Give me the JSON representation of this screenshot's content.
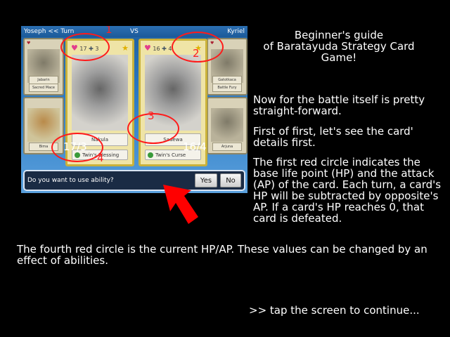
{
  "game": {
    "top_bar": {
      "left": "Yoseph << Turn",
      "center": "VS",
      "right": "Kyriel"
    },
    "left_card": {
      "hp": "17",
      "ap": "3",
      "name": "Nakula",
      "ability": "Twin's Blessing"
    },
    "right_card": {
      "hp": "16",
      "ap": "4",
      "name": "Sadewa",
      "ability": "Twin's Curse"
    },
    "left_total": "17/3",
    "right_total": "16/4",
    "side_cards": {
      "left_top_name": "Jabarin",
      "left_top_ability": "Sacred Mace",
      "left_bottom_name": "Bima",
      "right_top_name": "Gatotkaca",
      "right_top_ability": "Battle Fury",
      "right_bottom_name": "Arjuna"
    },
    "dialog": {
      "question": "Do you want to use ability?",
      "yes": "Yes",
      "no": "No"
    },
    "annotations": [
      "1",
      "2",
      "3",
      "4"
    ],
    "colors": {
      "annotation": "#ff1a1a",
      "board": "#2a79c4",
      "card_border": "#c9b13a"
    }
  },
  "guide": {
    "title": "Beginner's guide\nof Baratayuda Strategy Card\nGame!",
    "para1": "Now for the battle itself is pretty straight-forward.",
    "para2": "First of first, let's see the card' details first.",
    "para3": "The first red circle indicates the base life point (HP) and the attack (AP) of the card. Each turn, a card's HP will be subtracted by opposite's AP. If a card's HP reaches 0, that card is defeated.",
    "para4": "The fourth red circle is the current HP/AP. These values can be changed by an effect of abilities.",
    "continue": ">> tap the screen to continue..."
  }
}
